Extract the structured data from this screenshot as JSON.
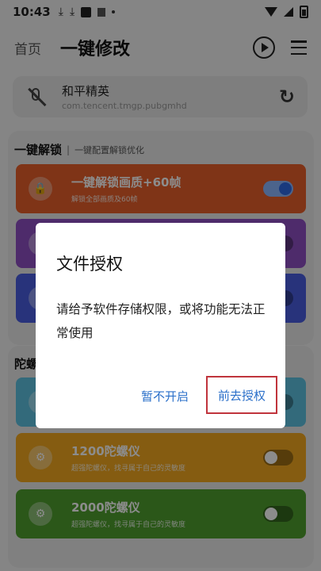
{
  "status_bar": {
    "time": "10:43"
  },
  "header": {
    "home_label": "首页",
    "title": "一键修改"
  },
  "game_card": {
    "name": "和平精英",
    "package": "com.tencent.tmgp.pubgmhd"
  },
  "unlock_section": {
    "title": "一键解锁",
    "separator": "|",
    "subtitle": "一键配置解锁优化"
  },
  "features": [
    {
      "name": "一键解锁画质+60帧",
      "desc": "解锁全部画质及60帧",
      "color": "#e8602a",
      "enabled": true
    },
    {
      "name": "",
      "desc": "",
      "color": "#8e4fc4",
      "enabled": false
    },
    {
      "name": "",
      "desc": "",
      "color": "#4a5ee0",
      "enabled": false
    }
  ],
  "gyro_section": {
    "title": "陀螺"
  },
  "gyro_items": [
    {
      "name": "",
      "desc": "",
      "color": "#5ec2e0",
      "enabled": false
    },
    {
      "name": "1200陀螺仪",
      "desc": "超强陀螺仪，找寻属于自己的灵敏度",
      "color": "#f2a81f",
      "enabled": false
    },
    {
      "name": "2000陀螺仪",
      "desc": "超强陀螺仪，找寻属于自己的灵敏度",
      "color": "#4f9e2e",
      "enabled": false
    }
  ],
  "dialog": {
    "title": "文件授权",
    "message": "请给予软件存储权限，或将功能无法正常使用",
    "cancel_label": "暂不开启",
    "confirm_label": "前去授权",
    "accent_color": "#2a6fc9"
  }
}
